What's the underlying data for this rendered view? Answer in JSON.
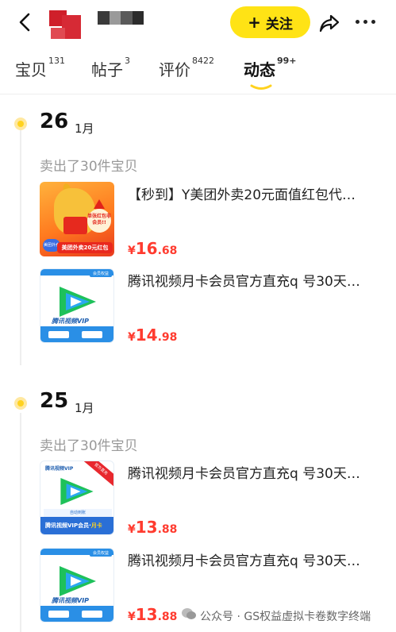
{
  "header": {
    "follow_label": "关注",
    "follow_icon": "plus-icon",
    "back_icon": "back-chevron-icon",
    "share_icon": "share-icon",
    "more_icon": "more-dots-icon"
  },
  "tabs": [
    {
      "label": "宝贝",
      "count": "131"
    },
    {
      "label": "帖子",
      "count": "3"
    },
    {
      "label": "评价",
      "count": "8422"
    },
    {
      "label": "动态",
      "count": "99+"
    }
  ],
  "timeline": [
    {
      "day": "26",
      "month": "1月",
      "summary": "卖出了30件宝贝",
      "items": [
        {
          "title": "【秒到】Y美团外卖20元面值红包代…",
          "price_cur": "¥",
          "price_int": "16",
          "price_dec": ".68",
          "thumb_text": {
            "badge": "单张红包非会员!!",
            "bar": "美团外卖20元红包",
            "tag": "美团外卖"
          }
        },
        {
          "title": "腾讯视频月卡会员官方直充q 号30天…",
          "price_cur": "¥",
          "price_int": "14",
          "price_dec": ".98",
          "thumb_text": {
            "vip": "腾讯视频VIP",
            "corner": "会员权益"
          }
        }
      ]
    },
    {
      "day": "25",
      "month": "1月",
      "summary": "卖出了30件宝贝",
      "items": [
        {
          "title": "腾讯视频月卡会员官方直充q 号30天…",
          "price_cur": "¥",
          "price_int": "13",
          "price_dec": ".88",
          "thumb_text": {
            "top": "腾讯视频VIP",
            "ribbon": "官方直充",
            "strip": "自动到账",
            "foot": "腾讯视频VIP会员·",
            "foot_bold": "月卡"
          }
        },
        {
          "title": "腾讯视频月卡会员官方直充q 号30天…",
          "price_cur": "¥",
          "price_int": "13",
          "price_dec": ".88",
          "thumb_text": {
            "vip": "腾讯视频VIP",
            "corner": "会员权益"
          }
        }
      ]
    }
  ],
  "watermark": "公众号 · GS权益虚拟卡卷数字终端",
  "colors": {
    "accent": "#ffe315",
    "price": "#ff3b2f",
    "dot": "#ffd21e"
  }
}
